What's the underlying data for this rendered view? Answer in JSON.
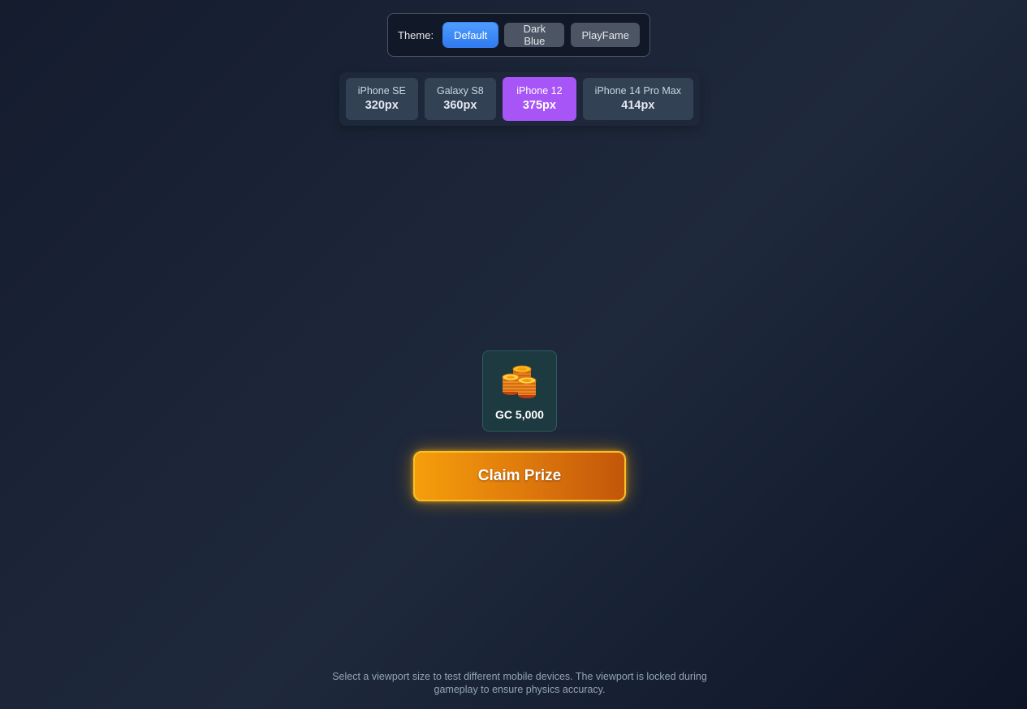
{
  "theme_bar": {
    "label": "Theme:",
    "options": [
      {
        "label": "Default",
        "active": true
      },
      {
        "label": "Dark Blue",
        "active": false
      },
      {
        "label": "PlayFame",
        "active": false
      }
    ]
  },
  "devices": [
    {
      "name": "iPhone SE",
      "size": "320px",
      "active": false
    },
    {
      "name": "Galaxy S8",
      "size": "360px",
      "active": false
    },
    {
      "name": "iPhone 12",
      "size": "375px",
      "active": true
    },
    {
      "name": "iPhone 14 Pro Max",
      "size": "414px",
      "active": false
    }
  ],
  "prize": {
    "icon": "coin-stack-icon",
    "amount": "GC 5,000"
  },
  "claim_button": {
    "label": "Claim Prize"
  },
  "footer": {
    "note": "Select a viewport size to test different mobile devices. The viewport is locked during gameplay to ensure physics accuracy."
  },
  "colors": {
    "theme_active": "#3b82f6",
    "device_active": "#a855f7",
    "claim_button": "#f59e0b"
  }
}
